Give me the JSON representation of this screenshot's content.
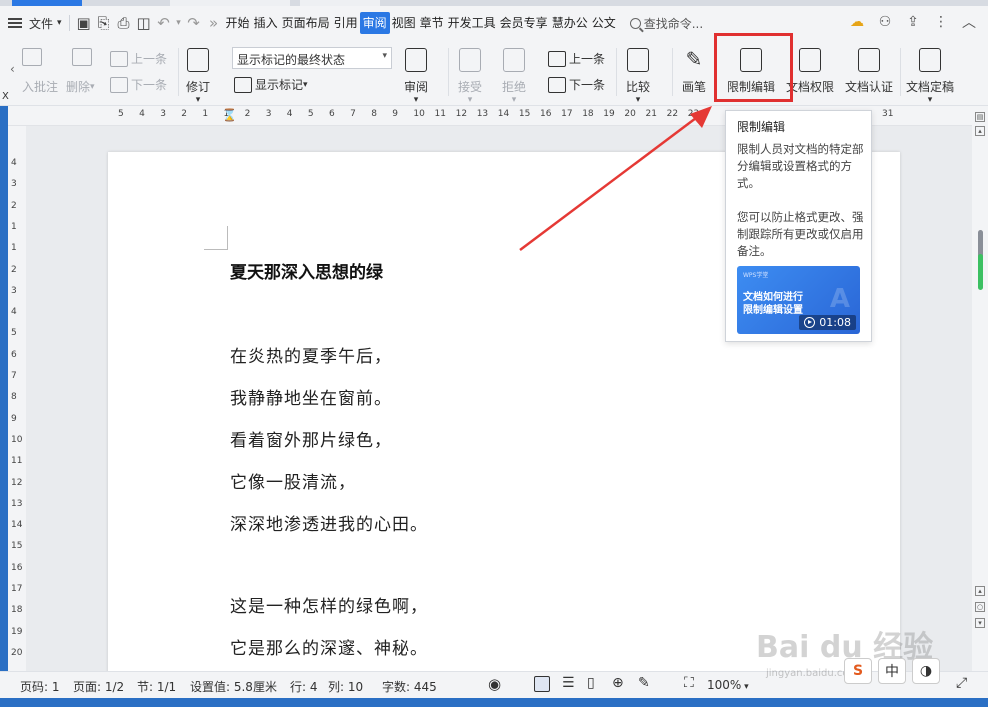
{
  "menubar": {
    "file_label": "文件",
    "tabs": [
      "开始",
      "插入",
      "页面布局",
      "引用",
      "审阅",
      "视图",
      "章节",
      "开发工具",
      "会员专享",
      "慧办公",
      "公文"
    ],
    "active_tab": "审阅",
    "search_placeholder": "查找命令..."
  },
  "ribbon": {
    "add_comment": "入批注",
    "delete": "删除",
    "prev_comment": "上一条",
    "next_comment": "下一条",
    "track_changes": "修订",
    "markup_select": "显示标记的最终状态",
    "show_markup": "显示标记",
    "review": "审阅",
    "accept": "接受",
    "reject": "拒绝",
    "prev_change": "上一条",
    "next_change": "下一条",
    "compare": "比较",
    "ink": "画笔",
    "restrict_edit": "限制编辑",
    "doc_permission": "文档权限",
    "doc_certify": "文档认证",
    "doc_finalize": "文档定稿"
  },
  "ruler": {
    "h_labels": [
      "5",
      "4",
      "3",
      "2",
      "1",
      "1",
      "2",
      "3",
      "4",
      "5",
      "6",
      "7",
      "8",
      "9",
      "10",
      "11",
      "12",
      "13",
      "14",
      "15",
      "16",
      "17",
      "18",
      "19",
      "20",
      "21",
      "22",
      "23",
      "31"
    ],
    "v_labels": [
      "4",
      "3",
      "2",
      "1",
      "1",
      "2",
      "3",
      "4",
      "5",
      "6",
      "7",
      "8",
      "9",
      "10",
      "11",
      "12",
      "13",
      "14",
      "15",
      "16",
      "17",
      "18",
      "19",
      "20"
    ]
  },
  "document": {
    "title": "夏天那深入思想的绿",
    "lines": [
      "在炎热的夏季午后，",
      "我静静地坐在窗前。",
      "看着窗外那片绿色，",
      "它像一股清流，",
      "深深地渗透进我的心田。",
      "这是一种怎样的绿色啊，",
      "它是那么的深邃、神秘。"
    ]
  },
  "tooltip": {
    "title": "限制编辑",
    "desc": "限制人员对文档的特定部分编辑或设置格式的方式。",
    "desc2": "您可以防止格式更改、强制跟踪所有更改或仅启用备注。",
    "video_brand": "WPS学堂",
    "video_line1": "文档如何进行",
    "video_line2": "限制编辑设置",
    "video_duration": "01:08"
  },
  "statusbar": {
    "page_num": "页码: 1",
    "pages": "页面: 1/2",
    "section": "节: 1/1",
    "setting": "设置值: 5.8厘米",
    "row": "行: 4",
    "col": "列: 10",
    "word_count": "字数: 445",
    "zoom": "100%"
  },
  "ime": {
    "lang": "中"
  },
  "watermark": {
    "brand": "Bai du 经验",
    "url": "jingyan.baidu.com"
  },
  "colors": {
    "accent": "#2b78e4",
    "highlight": "#e03030",
    "green": "#3cc062"
  }
}
